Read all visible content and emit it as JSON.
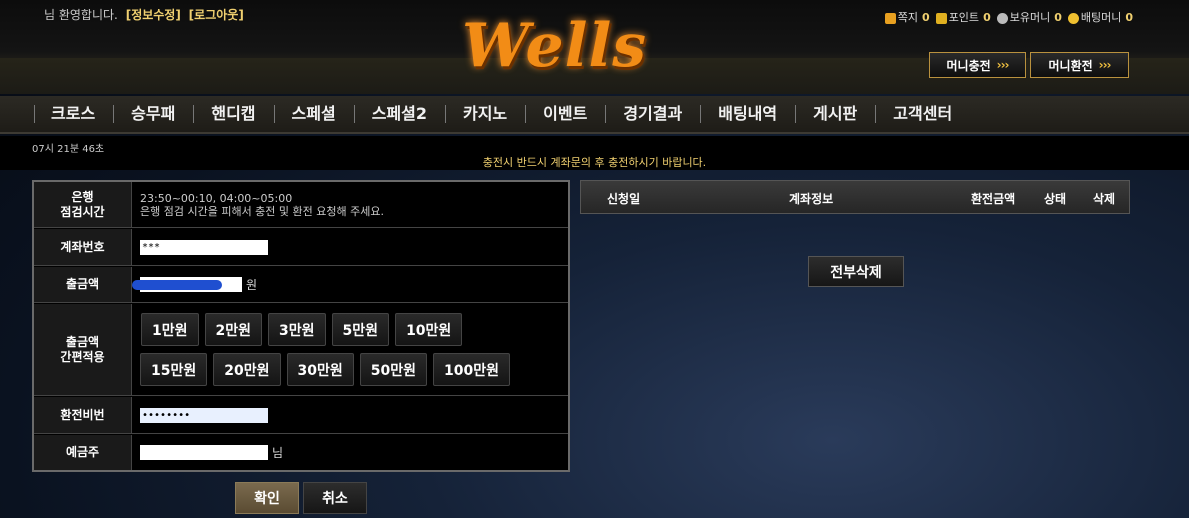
{
  "header": {
    "welcome_text": "님 환영합니다.",
    "edit_info_label": "[정보수정]",
    "logout_label": "[로그아웃]",
    "logo_text": "Wells",
    "stats": {
      "message_label": "쪽지",
      "message_count": "0",
      "point_label": "포인트",
      "point_value": "0",
      "holding_money_label": "보유머니",
      "holding_money_value": "0",
      "betting_money_label": "배팅머니",
      "betting_money_value": "0"
    },
    "deposit_button": "머니충전",
    "withdraw_button": "머니환전",
    "arrows": "›››"
  },
  "nav": {
    "items": [
      "크로스",
      "승무패",
      "핸디캡",
      "스페셜",
      "스페셜2",
      "카지노",
      "이벤트",
      "경기결과",
      "배팅내역",
      "게시판",
      "고객센터"
    ]
  },
  "status": {
    "time": "07시 21분 46초",
    "notice": "충전시 반드시 계좌문의 후 충전하시기 바랍니다."
  },
  "form": {
    "bank_check_label_1": "은행",
    "bank_check_label_2": "점검시간",
    "bank_check_time": "23:50~00:10, 04:00~05:00",
    "bank_check_note": "은행 점검 시간을 피해서 충전 및 환전 요청해 주세요.",
    "account_label": "계좌번호",
    "account_value": "***",
    "amount_label": "출금액",
    "amount_unit": "원",
    "quick_label_1": "출금액",
    "quick_label_2": "간편적용",
    "quick_amounts_row1": [
      "1만원",
      "2만원",
      "3만원",
      "5만원",
      "10만원"
    ],
    "quick_amounts_row2": [
      "15만원",
      "20만원",
      "30만원",
      "50만원",
      "100만원"
    ],
    "password_label": "환전비번",
    "password_value": "••••••••",
    "holder_label": "예금주",
    "holder_suffix": "님",
    "confirm_button": "확인",
    "cancel_button": "취소"
  },
  "history": {
    "columns": [
      "신청일",
      "계좌정보",
      "환전금액",
      "상태",
      "삭제"
    ],
    "delete_all_button": "전부삭제"
  },
  "colors": {
    "accent_gold": "#f0d070",
    "logo_orange": "#f28c16"
  }
}
